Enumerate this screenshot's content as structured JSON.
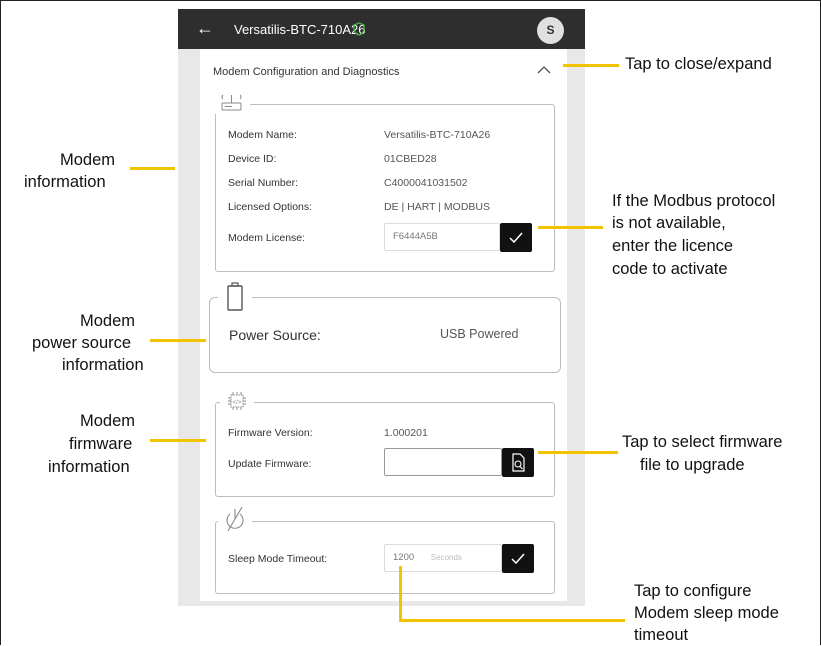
{
  "topbar": {
    "back_label": "←",
    "device_name": "Versatilis-BTC-710A26",
    "avatar_initial": "S"
  },
  "section": {
    "title": "Modem Configuration and Diagnostics"
  },
  "modem_info": {
    "rows": [
      {
        "label": "Modem Name:",
        "value": "Versatilis-BTC-710A26"
      },
      {
        "label": "Device ID:",
        "value": "01CBED28"
      },
      {
        "label": "Serial Number:",
        "value": "C4000041031502"
      },
      {
        "label": "Licensed Options:",
        "value": "DE | HART | MODBUS"
      }
    ],
    "license_label": "Modem License:",
    "license_value": "F6444A5B"
  },
  "power": {
    "label": "Power Source:",
    "value": "USB Powered"
  },
  "firmware": {
    "version_label": "Firmware Version:",
    "version_value": "1.000201",
    "update_label": "Update Firmware:",
    "update_value": ""
  },
  "sleep": {
    "label": "Sleep Mode Timeout:",
    "value": "1200",
    "unit": "Seconds"
  },
  "annotations": {
    "close_expand": "Tap to close/expand",
    "modem_info_1": "Modem",
    "modem_info_2": "information",
    "modbus_1": "If the Modbus protocol",
    "modbus_2": "is not available,",
    "modbus_3": "enter the licence",
    "modbus_4": "code to activate",
    "power_1": "Modem",
    "power_2": "power source",
    "power_3": "information",
    "firmware_1": "Modem",
    "firmware_2": "firmware",
    "firmware_3": "information",
    "select_fw_1": "Tap to select firmware",
    "select_fw_2": "file to upgrade",
    "sleep_1": "Tap to configure",
    "sleep_2": "Modem sleep mode",
    "sleep_3": "timeout"
  },
  "colors": {
    "accent_yellow": "#f2c300",
    "topbar": "#2e2e2e",
    "shield_green": "#4caf50"
  },
  "icons": [
    "back-arrow-icon",
    "shield-icon",
    "chevron-up-icon",
    "router-icon",
    "battery-icon",
    "chip-icon",
    "power-off-icon",
    "checkmark-icon",
    "file-search-icon"
  ]
}
